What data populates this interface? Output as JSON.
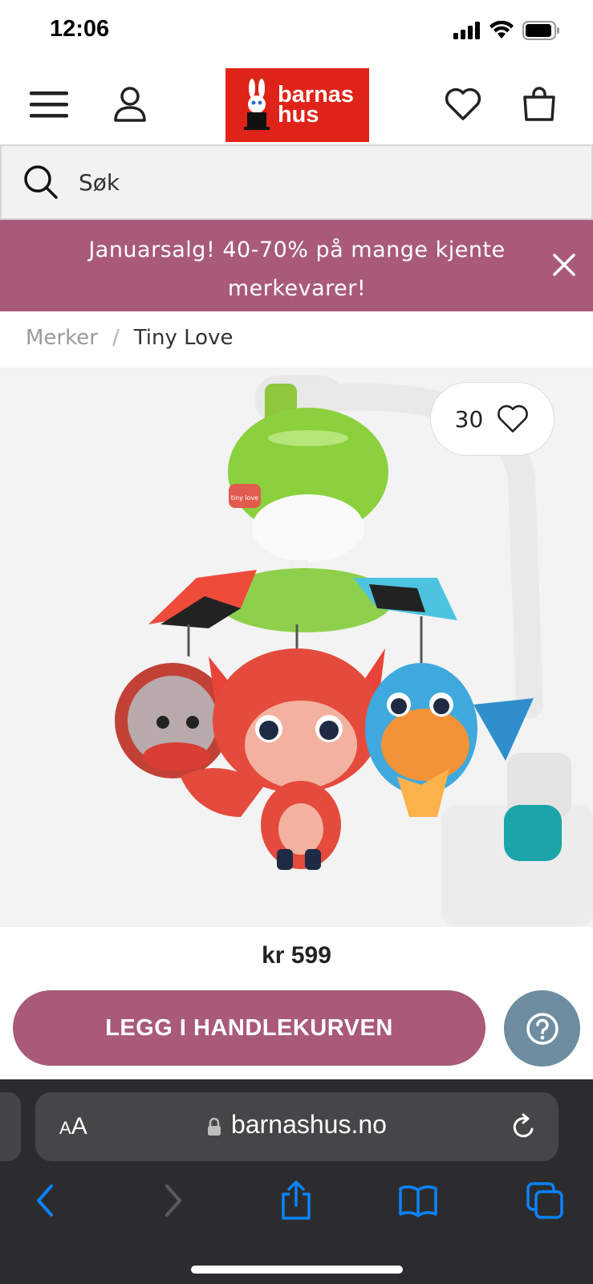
{
  "status_bar": {
    "time": "12:06"
  },
  "header": {
    "logo_line1": "barnas",
    "logo_line2": "hus",
    "colors": {
      "logo_bg": "#e02319"
    }
  },
  "search": {
    "placeholder": "Søk"
  },
  "promo": {
    "text": "Januarsalg! 40-70% på mange kjente merkevarer!",
    "color": "#a95a79"
  },
  "breadcrumb": {
    "items": [
      {
        "label": "Merker"
      },
      {
        "label": "Tiny Love"
      }
    ],
    "separator": "/"
  },
  "product": {
    "favorites_count": "30",
    "price": "kr 599",
    "image_logo_text": "tiny love"
  },
  "actions": {
    "add_to_cart_label": "LEGG I HANDLEKURVEN",
    "help_icon": "question-circle-icon",
    "cta_color": "#a95a79",
    "help_color": "#6e8da0"
  },
  "browser": {
    "aa_large": "A",
    "aa_small": "A",
    "url": "barnashus.no",
    "toolbar_icons": [
      "back-icon",
      "forward-icon",
      "share-icon",
      "bookmarks-icon",
      "tabs-icon"
    ],
    "accent": "#0a84ff"
  }
}
